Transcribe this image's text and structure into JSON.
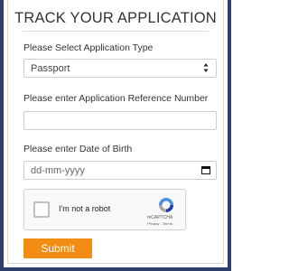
{
  "form": {
    "title": "TRACK YOUR APPLICATION",
    "application_type": {
      "label": "Please Select Application Type",
      "selected": "Passport"
    },
    "reference_number": {
      "label": "Please enter Application Reference Number",
      "value": ""
    },
    "date_of_birth": {
      "label": "Please enter Date of Birth",
      "placeholder": "dd-mm-yyyy"
    },
    "captcha": {
      "checkbox_label": "I'm not a robot",
      "brand": "reCAPTCHA",
      "links": "Privacy - Terms"
    },
    "submit_label": "Submit"
  },
  "colors": {
    "accent": "#f28c13",
    "frame": "#2c3e6b",
    "captcha_blue": "#4a90e2"
  },
  "icons": [
    "select-arrows-icon",
    "calendar-icon",
    "recaptcha-logo-icon"
  ]
}
